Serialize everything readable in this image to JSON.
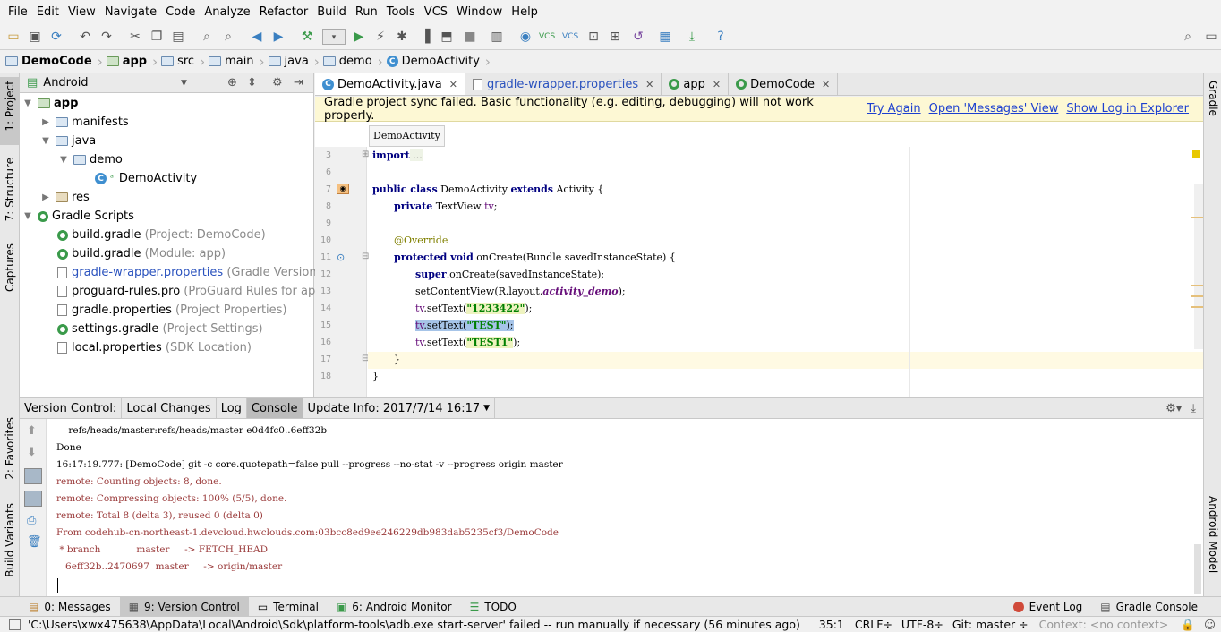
{
  "menubar": {
    "items": [
      "File",
      "Edit",
      "View",
      "Navigate",
      "Code",
      "Analyze",
      "Refactor",
      "Build",
      "Run",
      "Tools",
      "VCS",
      "Window",
      "Help"
    ]
  },
  "navbar": {
    "crumbs": [
      "DemoCode",
      "app",
      "src",
      "main",
      "java",
      "demo",
      "DemoActivity"
    ]
  },
  "left_strip": {
    "project": "1: Project",
    "structure": "7: Structure",
    "captures": "Captures",
    "favorites": "2: Favorites",
    "build_variants": "Build Variants"
  },
  "right_strip": {
    "gradle": "Gradle",
    "android_model": "Android Model"
  },
  "project_panel": {
    "view_mode": "Android",
    "tree": [
      {
        "label": "app",
        "hint": ""
      },
      {
        "label": "manifests",
        "hint": ""
      },
      {
        "label": "java",
        "hint": ""
      },
      {
        "label": "demo",
        "hint": ""
      },
      {
        "label": "DemoActivity",
        "hint": ""
      },
      {
        "label": "res",
        "hint": ""
      },
      {
        "label": "Gradle Scripts",
        "hint": ""
      },
      {
        "label": "build.gradle",
        "hint": "(Project: DemoCode)"
      },
      {
        "label": "build.gradle",
        "hint": "(Module: app)"
      },
      {
        "label": "gradle-wrapper.properties",
        "hint": "(Gradle Version)"
      },
      {
        "label": "proguard-rules.pro",
        "hint": "(ProGuard Rules for app)"
      },
      {
        "label": "gradle.properties",
        "hint": "(Project Properties)"
      },
      {
        "label": "settings.gradle",
        "hint": "(Project Settings)"
      },
      {
        "label": "local.properties",
        "hint": "(SDK Location)"
      }
    ]
  },
  "editor_tabs": [
    "DemoActivity.java",
    "gradle-wrapper.properties",
    "app",
    "DemoCode"
  ],
  "banner": {
    "message": "Gradle project sync failed. Basic functionality (e.g. editing, debugging) will not work properly.",
    "try_again": "Try Again",
    "open_messages": "Open 'Messages' View",
    "show_log": "Show Log in Explorer"
  },
  "breadcrumb_tip": "DemoActivity",
  "code": {
    "line_numbers": [
      "3",
      "6",
      "7",
      "8",
      "9",
      "10",
      "11",
      "12",
      "13",
      "14",
      "15",
      "16",
      "17",
      "18"
    ],
    "l3_kw": "import",
    "l3_rest": " ...",
    "l7_a": "public class",
    "l7_b": " DemoActivity ",
    "l7_c": "extends",
    "l7_d": " Activity {",
    "l8_a": "private",
    "l8_b": " TextView ",
    "l8_c": "tv",
    "l8_d": ";",
    "l10": "@Override",
    "l11_a": "protected void",
    "l11_b": " onCreate(Bundle savedInstanceState) {",
    "l12_a": "super",
    "l12_b": ".onCreate(savedInstanceState);",
    "l13_a": "setContentView(R.layout.",
    "l13_b": "activity_demo",
    "l13_c": ");",
    "l14_a": "tv",
    "l14_b": ".setText(",
    "l14_c": "\"1233422\"",
    "l14_d": ");",
    "l15_a": "tv",
    "l15_b": ".setText(",
    "l15_c": "\"TEST\"",
    "l15_d": ");",
    "l16_a": "tv",
    "l16_b": ".setText(",
    "l16_c": "\"TEST1\"",
    "l16_d": ");",
    "l17": "}",
    "l18": "}"
  },
  "vc_bar": {
    "label": "Version Control:",
    "local_changes": "Local Changes",
    "log": "Log",
    "console": "Console",
    "update_info": "Update Info: 2017/7/14 16:17"
  },
  "console_lines": [
    "    refs/heads/master:refs/heads/master e0d4fc0..6eff32b",
    "Done",
    "16:17:19.777: [DemoCode] git -c core.quotepath=false pull --progress --no-stat -v --progress origin master",
    "remote: Counting objects: 8, done.",
    "remote: Compressing objects: 100% (5/5), done.",
    "remote: Total 8 (delta 3), reused 0 (delta 0)",
    "From codehub-cn-northeast-1.devcloud.hwclouds.com:03bcc8ed9ee246229db983dab5235cf3/DemoCode",
    " * branch            master     -> FETCH_HEAD",
    "   6eff32b..2470697  master     -> origin/master"
  ],
  "bottom_tabs": {
    "messages": "0: Messages",
    "version_control": "9: Version Control",
    "terminal": "Terminal",
    "android_monitor": "6: Android Monitor",
    "todo": "TODO",
    "event_log": "Event Log",
    "gradle_console": "Gradle Console"
  },
  "status": {
    "message": "'C:\\Users\\xwx475638\\AppData\\Local\\Android\\Sdk\\platform-tools\\adb.exe start-server' failed -- run manually if necessary (56 minutes ago)",
    "position": "35:1",
    "line_sep": "CRLF÷",
    "encoding": "UTF-8÷",
    "git": "Git: master ÷",
    "context": "Context: <no context>"
  }
}
